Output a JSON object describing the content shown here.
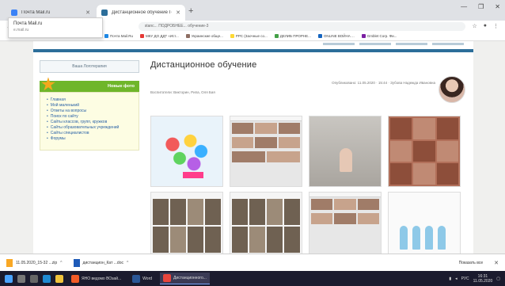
{
  "browser": {
    "tabs": [
      {
        "title": "Почта Mail.ru",
        "active": false,
        "color": "#3b82f6"
      },
      {
        "title": "Дистанционное обучение Го...",
        "active": true,
        "color": "#2c6e9a"
      }
    ],
    "tooltip": {
      "title": "Почта Mail.ru",
      "subtitle": "e.mail.ru"
    },
    "address": "stanc... ПОДРОБНЕЕ... обучение-3",
    "bookmarks": [
      {
        "label": "Почта Mail.Ru",
        "color": "#1e88e5"
      },
      {
        "label": "МКУ ДО ДДТ «Ист...",
        "color": "#e53935"
      },
      {
        "label": "Украинские обще...",
        "color": "#8d6e63"
      },
      {
        "label": "РРС (Заочные со...",
        "color": "#fdd835"
      },
      {
        "label": "ДЕЛИБ ПРОРНЕ...",
        "color": "#43a047"
      },
      {
        "label": "ONLINE ВОЙНА ...",
        "color": "#1565c0"
      },
      {
        "label": "Gmblet Corp. Фи...",
        "color": "#7b1fa2"
      }
    ]
  },
  "site": {
    "logo_text": "Ваша Логотерапия",
    "news_header": "Новые фото",
    "menu": [
      "Главная",
      "Мой маленький",
      "Ответы на вопросы",
      "Поиск по сайту",
      "Сайты классов, групп, кружков",
      "Сайты образовательных учреждений",
      "Сайты специалистов",
      "Форумы"
    ],
    "page_title": "Дистанционное обучение",
    "meta": "Опубликовано: 11.05.2020 · 15:44 · Зубова Надежда Ивановна",
    "authors": "Воспитатели: Викторин, Рипа, Оля Бая"
  },
  "downloads": {
    "items": [
      {
        "name": "11.05.2020_15-32 ...zip",
        "color": "#f9a825"
      },
      {
        "name": "дистанцион_Кат ...doc",
        "color": "#1e5bb8"
      }
    ],
    "show_all": "Показать все"
  },
  "taskbar": {
    "tasks": [
      {
        "label": "ЯНО ведомо ВОзай...",
        "active": false
      },
      {
        "label": "Word",
        "active": false
      },
      {
        "label": "Дистанционного...",
        "active": true
      }
    ],
    "time": "16:31",
    "date": "11.05.2020"
  }
}
